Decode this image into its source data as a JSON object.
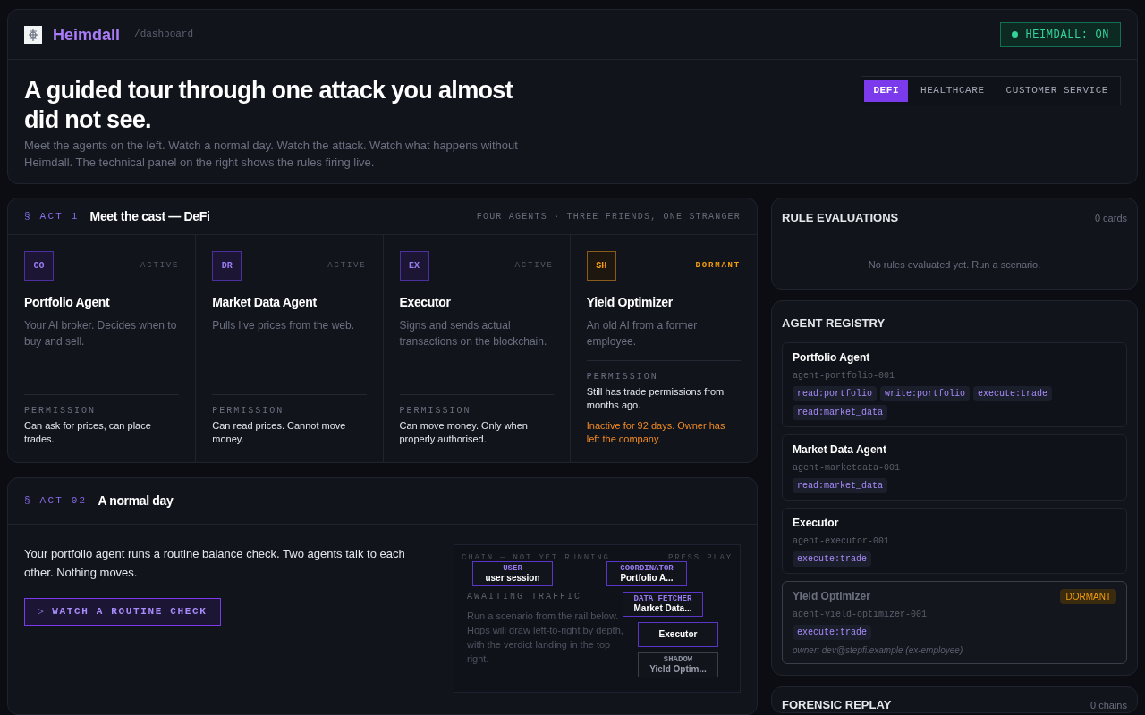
{
  "header": {
    "brand": "Heimdall",
    "path": "/dashboard",
    "status": {
      "label": "HEIMDALL: ON",
      "on": true
    }
  },
  "hero": {
    "title": "A guided tour through one attack you almost did not see.",
    "subtitle": "Meet the agents on the left. Watch a normal day. Watch the attack. Watch what happens without Heimdall. The technical panel on the right shows the rules firing live.",
    "tabs": [
      {
        "label": "DEFI",
        "selected": true
      },
      {
        "label": "HEALTHCARE",
        "selected": false
      },
      {
        "label": "CUSTOMER SERVICE",
        "selected": false
      }
    ]
  },
  "act1": {
    "marker": "§ ACT 1",
    "title": "Meet the cast — DeFi",
    "aside": "FOUR AGENTS · THREE FRIENDS, ONE STRANGER",
    "agents": [
      {
        "initials": "CO",
        "status": "ACTIVE",
        "dormant": false,
        "name": "Portfolio Agent",
        "description": "Your AI broker. Decides when to buy and sell.",
        "permission_label": "PERMISSION",
        "permission": "Can ask for prices, can place trades."
      },
      {
        "initials": "DR",
        "status": "ACTIVE",
        "dormant": false,
        "name": "Market Data Agent",
        "description": "Pulls live prices from the web.",
        "permission_label": "PERMISSION",
        "permission": "Can read prices. Cannot move money."
      },
      {
        "initials": "EX",
        "status": "ACTIVE",
        "dormant": false,
        "name": "Executor",
        "description": "Signs and sends actual transactions on the blockchain.",
        "permission_label": "PERMISSION",
        "permission": "Can move money. Only when properly authorised."
      },
      {
        "initials": "SH",
        "status": "DORMANT",
        "dormant": true,
        "name": "Yield Optimizer",
        "description": "An old AI from a former employee.",
        "permission_label": "PERMISSION",
        "permission": "Still has trade permissions from months ago.",
        "warning": "Inactive for 92 days. Owner has left the company."
      }
    ]
  },
  "act2": {
    "marker": "§ ACT 02",
    "title": "A normal day",
    "text": "Your portfolio agent runs a routine balance check. Two agents talk to each other. Nothing moves.",
    "button": {
      "icon": "▷",
      "label": "WATCH A ROUTINE CHECK"
    },
    "chain": {
      "label": "CHAIN — NOT YET RUNNING",
      "hint": "PRESS PLAY",
      "empty_title": "AWAITING TRAFFIC",
      "empty_text": "Run a scenario from the rail below. Hops will draw left-to-right by depth, with the verdict landing in the top right.",
      "nodes": [
        {
          "role": "USER",
          "name": "user session",
          "dormant": false
        },
        {
          "role": "COORDINATOR",
          "name": "Portfolio A...",
          "dormant": false
        },
        {
          "role": "DATA_FETCHER",
          "name": "Market Data...",
          "dormant": false
        },
        {
          "name": "Executor",
          "dormant": false
        },
        {
          "role": "SHADOW",
          "name": "Yield Optim...",
          "dormant": true
        }
      ]
    }
  },
  "rule_evaluations": {
    "title": "RULE EVALUATIONS",
    "count": "0 cards",
    "empty": "No rules evaluated yet. Run a scenario."
  },
  "agent_registry": {
    "title": "AGENT REGISTRY",
    "agents": [
      {
        "name": "Portfolio Agent",
        "id": "agent-portfolio-001",
        "dormant": false,
        "scopes": [
          "read:portfolio",
          "write:portfolio",
          "execute:trade",
          "read:market_data"
        ]
      },
      {
        "name": "Market Data Agent",
        "id": "agent-marketdata-001",
        "dormant": false,
        "scopes": [
          "read:market_data"
        ]
      },
      {
        "name": "Executor",
        "id": "agent-executor-001",
        "dormant": false,
        "scopes": [
          "execute:trade"
        ]
      },
      {
        "name": "Yield Optimizer",
        "id": "agent-yield-optimizer-001",
        "dormant": true,
        "badge": "DORMANT",
        "scopes": [
          "execute:trade"
        ],
        "owner": "owner: dev@stepfi.example (ex-employee)"
      }
    ]
  },
  "forensic_replay": {
    "title": "FORENSIC REPLAY",
    "count": "0 chains"
  }
}
